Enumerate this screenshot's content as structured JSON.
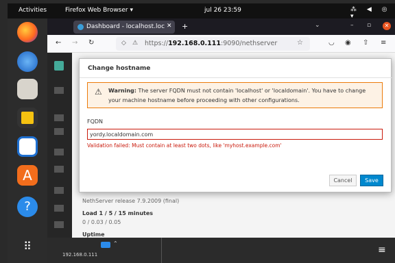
{
  "topbar": {
    "activities": "Activities",
    "app": "Firefox Web Browser ▾",
    "clock": "jul 26  23:59",
    "tray": "⁂ ◀ ◎ ▾"
  },
  "browser": {
    "tab_title": "Dashboard - localhost.loc",
    "tab_close": "✕",
    "new_tab": "+",
    "url_prefix": "https://",
    "url_host": "192.168.0.111",
    "url_rest": ":9090/nethserver"
  },
  "modal": {
    "title": "Change hostname",
    "warning_label": "Warning:",
    "warning_line1": " The server FQDN must not contain 'localhost' or 'localdomain'. You have to change",
    "warning_line2": "your machine hostname before proceeding with other configurations.",
    "fqdn_label": "FQDN",
    "fqdn_value": "yordy.localdomain.com",
    "error": "Validation failed: Must contain at least two dots, like 'myhost.example.com'",
    "cancel": "Cancel",
    "save": "Save"
  },
  "background": {
    "release": "NethServer release 7.9.2009 (final)",
    "load_title": "Load 1 / 5 / 15 minutes",
    "load_values": "0 / 0.03 / 0.05",
    "uptime": "Uptime"
  },
  "taskbar": {
    "label": "192.168.0.111"
  },
  "colors": {
    "accent": "#0088ce",
    "error": "#c9190b",
    "warning_border": "#ec7a08"
  }
}
